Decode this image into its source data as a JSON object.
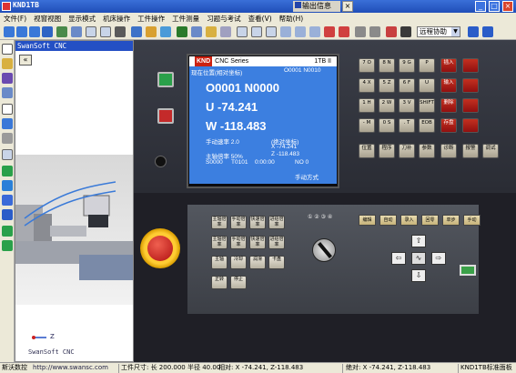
{
  "window": {
    "title": "KND1TB",
    "subwindow_title": "输出信息",
    "close_glyph": "×",
    "minimize_glyph": "_",
    "maximize_glyph": "□"
  },
  "menu": [
    "文件(F)",
    "视窗视图",
    "显示模式",
    "机床操作",
    "工件操作",
    "工件测量",
    "习题与考试",
    "查看(V)",
    "帮助(H)"
  ],
  "toolbar": {
    "remote_select": "远程协助",
    "caret": "▼"
  },
  "viewport": {
    "title": "SwanSoft CNC",
    "collapse_glyph": "«",
    "footer": "SwanSoft CNC",
    "axis_label": "Z"
  },
  "crt": {
    "brand": "KND",
    "series": "CNC Series",
    "model": "1TB II",
    "position_title": "现在位置(相对坐标)",
    "program_ref": "O0001 N0010",
    "program_line": "O0001  N0000",
    "u_value": "U  -74.241",
    "w_value": "W  -118.483",
    "feed_rate": "手动速率 2.0",
    "abs_title": "(绝对坐标)",
    "abs_x": "X      -74.241",
    "spindle": "主轴倍率 50%",
    "abs_z": "Z     -118.483",
    "status_s": "S0000",
    "status_t": "T0101",
    "status_time": "0:00:00",
    "status_no": "NO 0",
    "mode": "手动方式"
  },
  "keypad": [
    [
      "7 O",
      "8 N",
      "9 G",
      "P",
      "插入"
    ],
    [
      "4 X",
      "5 Z",
      "6 F",
      "U",
      "输入"
    ],
    [
      "1 H",
      "2 W",
      "3 V",
      "SHIFT",
      "删除"
    ],
    [
      "- M",
      "0 S",
      ". T",
      "EOB",
      "存盘"
    ],
    [
      "位置",
      "程序",
      "刀补",
      "参数",
      "诊断",
      "报警",
      "调试"
    ]
  ],
  "operation_panel": {
    "mode_buttons": [
      "编辑",
      "自动",
      "录入",
      "回零",
      "单步",
      "手动"
    ],
    "left_buttons": [
      "主轴倍率",
      "手动倍率",
      "快速倍率",
      "进给倍率",
      "主轴倍率",
      "手动倍率",
      "快速倍率",
      "进给倍率",
      "主轴",
      "冷却",
      "润滑",
      "卡盘",
      "正转",
      "停止",
      "反转",
      "尾座"
    ],
    "arrows": {
      "up": "⇧",
      "down": "⇩",
      "left": "⇦",
      "right": "⇨",
      "rapid": "∿"
    }
  },
  "statusbar": {
    "company": "斯沃数控",
    "url": "http://www.swansc.com",
    "workpiece": "工件尺寸: 长 200.000 半径  40.00",
    "relative": "相对: X -74.241, Z-118.483",
    "absolute": "绝对: X -74.241, Z-118.483",
    "panel": "KND1TB标准面板"
  },
  "colors": {
    "crt_bg": "#3c7fe0",
    "titlebar": "#2450c4",
    "estop": "#c41a10"
  }
}
